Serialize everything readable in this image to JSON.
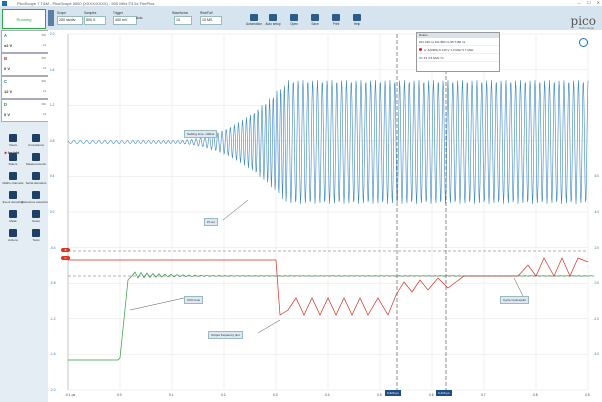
{
  "window": {
    "title": "PicoScope 7 T&M - PicoScope 5000 (XXXX/XXXX) - 500 MHz F3.5x FirePlus"
  },
  "toolbar": {
    "run_label": "Running",
    "scope_label": "Scope",
    "timebase": "200 ns/div",
    "samples_label": "Samples",
    "samples_value": "500 S",
    "trigger_label": "Trigger",
    "trigger_mode": "Auto",
    "trigger_level": "400 mV",
    "waveforms_label": "Waveforms",
    "waveforms_value": "10",
    "rise_label": "Rise/Fall",
    "rise_value": "10 MS",
    "buttons": [
      "Automation",
      "Auto setup",
      "Open",
      "Save",
      "Print",
      "Help"
    ]
  },
  "logo": {
    "text": "pico",
    "sub": "Technology"
  },
  "channels": [
    {
      "letter": "A",
      "color": "#1e6fb3",
      "range": "±2 V",
      "coupling": "DC",
      "probe": "x1",
      "bw": "Full"
    },
    {
      "letter": "B",
      "color": "#c62828",
      "range": "0 V",
      "coupling": "DC",
      "probe": "x1",
      "bw": "Full"
    },
    {
      "letter": "C",
      "color": "#1e6fb3",
      "range": "12 V",
      "coupling": "DC",
      "probe": "x1",
      "bw": "Full"
    },
    {
      "letter": "D",
      "color": "#2e7d32",
      "range": "0 V",
      "coupling": "DC",
      "probe": "x1",
      "bw": "Full"
    }
  ],
  "sidebar": {
    "insight": {
      "label": "Insight",
      "star": "★"
    },
    "items": [
      "Views",
      "Annotations",
      "Rulers",
      "Measurements",
      "Maths channels",
      "Serial decoders",
      "Event decoding",
      "Reference waveforms",
      "Mask",
      "Notes",
      "Actions",
      "Tools"
    ]
  },
  "plot": {
    "y_axis_a": [
      "2.0",
      "1.6",
      "1.2",
      "0.8",
      "0.4",
      "0.0",
      "-0.4",
      "-0.8",
      "-1.2",
      "-1.6",
      "-2.0"
    ],
    "y_axis_b": [
      "6.0",
      "4.0",
      "2.0",
      "0.0",
      "-2.0",
      "-4.0"
    ],
    "x_axis": [
      "-0.1 µs",
      "0.0",
      "0.1",
      "0.2",
      "0.3",
      "0.4",
      "0.5",
      "0.6",
      "0.7",
      "0.8",
      "0.9"
    ],
    "notes": {
      "settling": "Settling time ~300ns",
      "pi": "PI out",
      "vco": "VCO tune",
      "output": "Output frequency plot",
      "cycle": "Cycle Cycles/plot"
    },
    "cursors": [
      "0.329 µs",
      "0.416 µs"
    ],
    "measurements": {
      "header": "Rulers",
      "rows": [
        "321.199 ns   321.883 ns  95.7150 ns",
        "A: Δ(RMS)  5.120 V  1.3 MHz  5.7 MHz",
        "C1  X1 3.5 MHz  Y1"
      ]
    }
  }
}
